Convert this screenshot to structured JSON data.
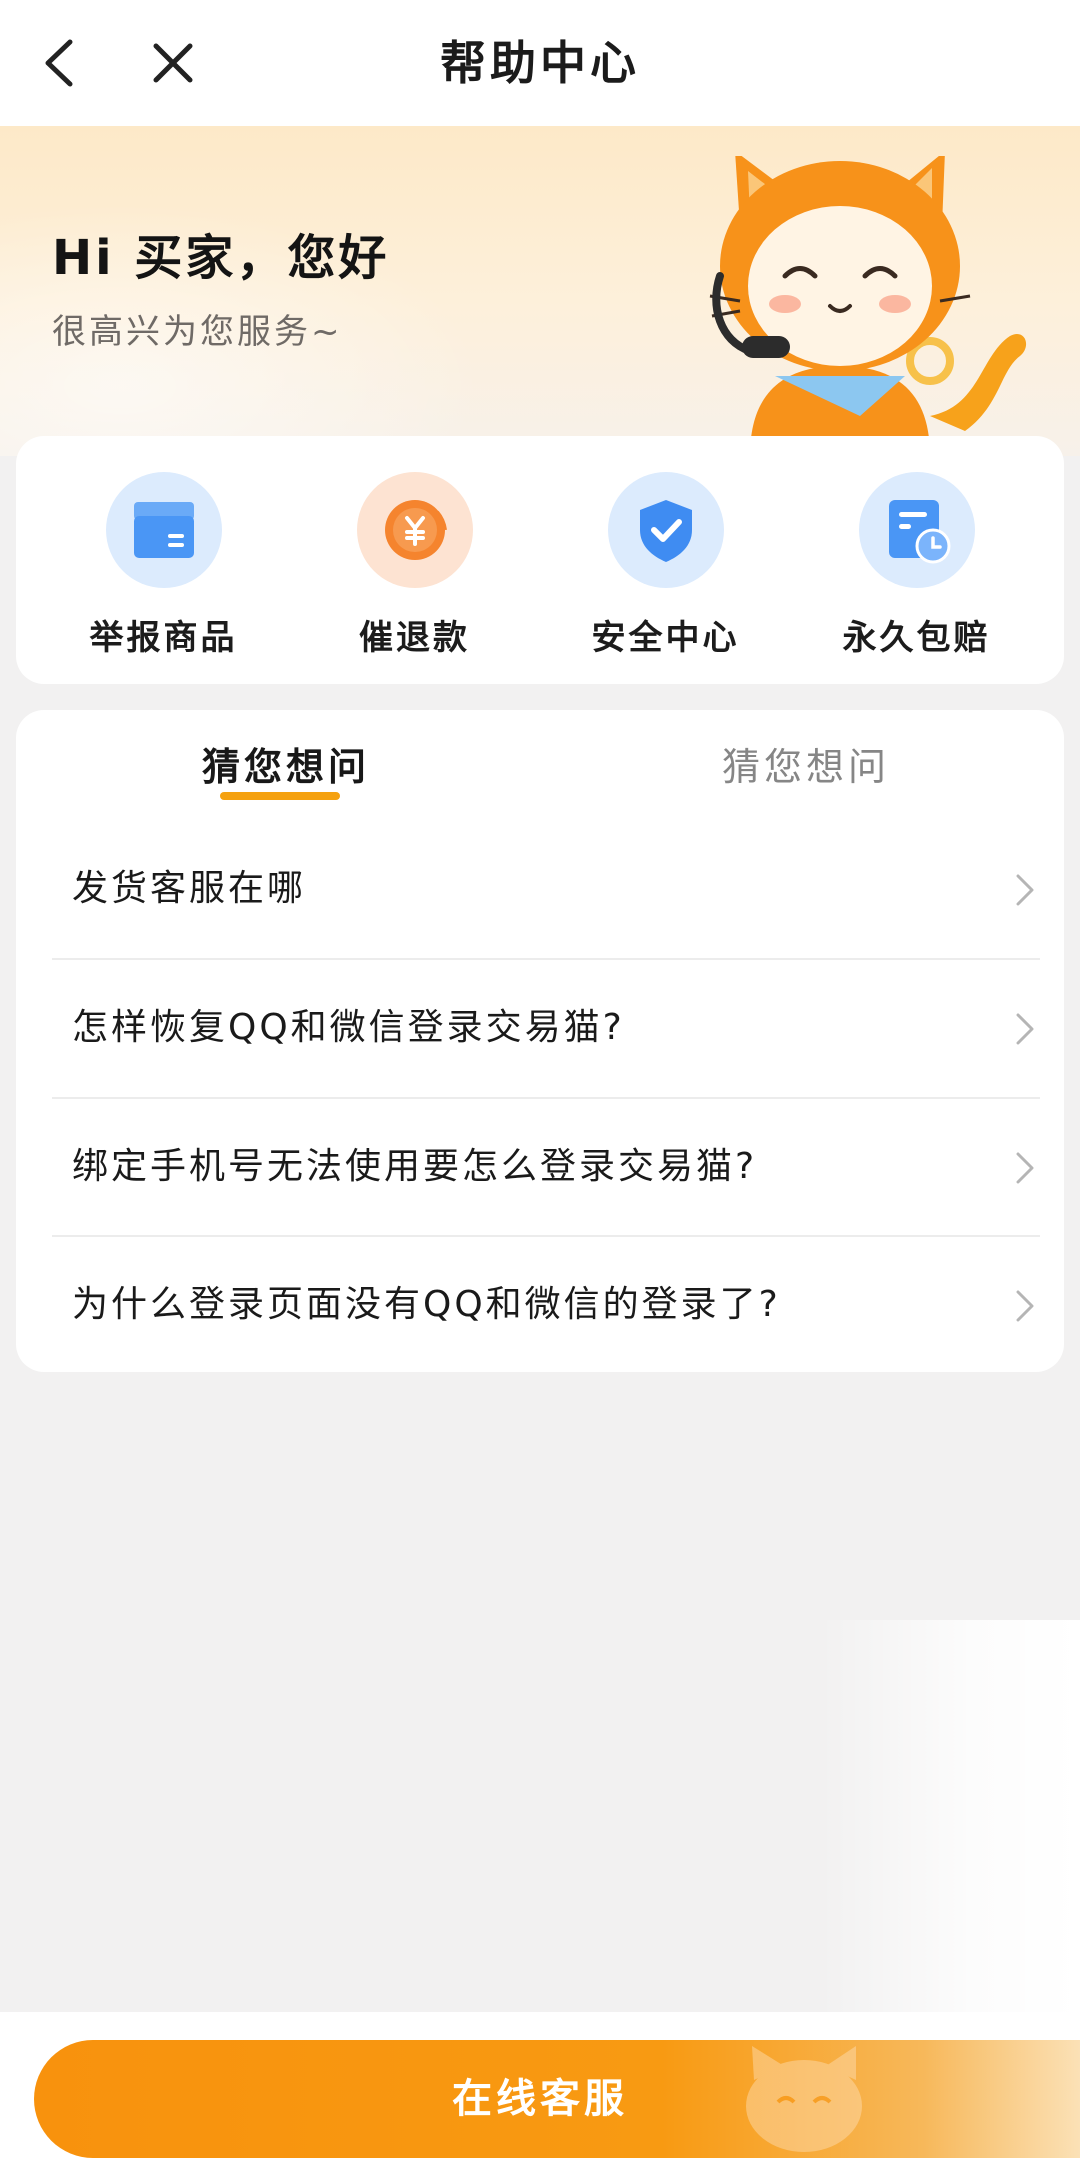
{
  "nav": {
    "title": "帮助中心",
    "back_icon": "chevron-left-icon",
    "close_icon": "close-icon"
  },
  "hero": {
    "greeting": "Hi 买家，您好",
    "subtitle": "很高兴为您服务~"
  },
  "quick_actions": [
    {
      "label": "举报商品",
      "icon": "report-card-icon",
      "color": "#4a96f5"
    },
    {
      "label": "催退款",
      "icon": "refund-yuan-icon",
      "color": "#f5842e"
    },
    {
      "label": "安全中心",
      "icon": "shield-check-icon",
      "color": "#3f8cf2"
    },
    {
      "label": "永久包赔",
      "icon": "document-clock-icon",
      "color": "#4a96f5"
    }
  ],
  "faq": {
    "tabs": [
      "猜您想问",
      "猜您想问"
    ],
    "active_tab": 0,
    "items": [
      "发货客服在哪",
      "怎样恢复QQ和微信登录交易猫?",
      "绑定手机号无法使用要怎么登录交易猫?",
      "为什么登录页面没有QQ和微信的登录了?"
    ]
  },
  "bottom": {
    "service_button": "在线客服"
  },
  "colors": {
    "accent": "#f8920d",
    "tab_underline": "#f5a10f",
    "background": "#f2f1f1"
  }
}
